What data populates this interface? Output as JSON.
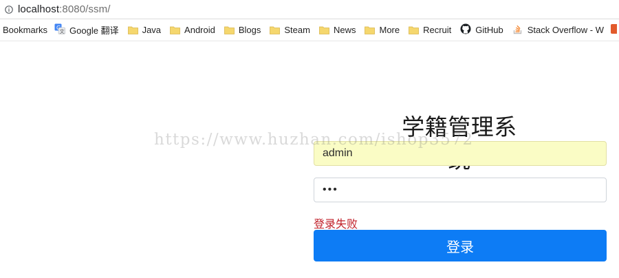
{
  "browser": {
    "url_host": "localhost",
    "url_rest": ":8080/ssm/",
    "bookmarks_label": "Bookmarks",
    "bookmarks": [
      {
        "label": "Google 翻译",
        "icon": "google-translate-icon"
      },
      {
        "label": "Java",
        "icon": "folder-icon"
      },
      {
        "label": "Android",
        "icon": "folder-icon"
      },
      {
        "label": "Blogs",
        "icon": "folder-icon"
      },
      {
        "label": "Steam",
        "icon": "folder-icon"
      },
      {
        "label": "News",
        "icon": "folder-icon"
      },
      {
        "label": "More",
        "icon": "folder-icon"
      },
      {
        "label": "Recruit",
        "icon": "folder-icon"
      },
      {
        "label": "GitHub",
        "icon": "github-icon"
      },
      {
        "label": "Stack Overflow - W",
        "icon": "stackoverflow-icon"
      }
    ]
  },
  "login": {
    "title": "学籍管理系统",
    "username_value": "admin",
    "password_value": "•••",
    "error_message": "登录失败",
    "submit_label": "登录"
  },
  "watermark": "https://www.huzhan.com/ishop3572",
  "colors": {
    "button": "#0d7cf5",
    "error": "#c0202a",
    "autofill": "#fafcc5"
  }
}
